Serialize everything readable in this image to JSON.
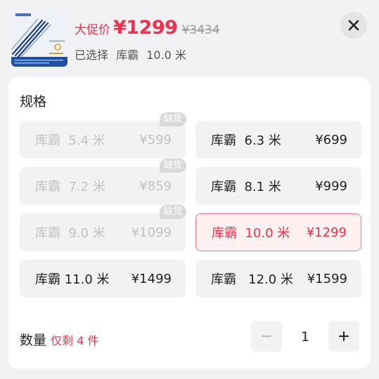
{
  "header": {
    "promo_label": "大促价",
    "price_now": "¥1299",
    "price_old": "¥3434",
    "selected_prefix": "已选择",
    "selected_name": "库霸",
    "selected_length": "10.0 米",
    "close_icon": "close-icon",
    "thumb_icon": "product-thumbnail-icon"
  },
  "spec": {
    "title": "规格",
    "badge_text": "缺货",
    "options": [
      {
        "name": "库霸  5.4 米",
        "price": "¥599",
        "state": "disabled",
        "badge": "缺货"
      },
      {
        "name": "库霸  6.3 米",
        "price": "¥699",
        "state": "normal"
      },
      {
        "name": "库霸  7.2 米",
        "price": "¥859",
        "state": "disabled",
        "badge": "缺货"
      },
      {
        "name": "库霸  8.1 米",
        "price": "¥999",
        "state": "normal"
      },
      {
        "name": "库霸  9.0 米",
        "price": "¥1099",
        "state": "disabled",
        "badge": "缺货"
      },
      {
        "name": "库霸  10.0 米",
        "price": "¥1299",
        "state": "selected"
      },
      {
        "name": "库霸 11.0 米",
        "price": "¥1499",
        "state": "normal"
      },
      {
        "name": "库霸   12.0 米",
        "price": "¥1599",
        "state": "normal"
      }
    ]
  },
  "quantity": {
    "label": "数量",
    "stock_note": "仅剩 4 件",
    "value": "1",
    "minus_icon": "minus-icon",
    "plus_icon": "plus-icon"
  },
  "colors": {
    "accent": "#f0314d",
    "disabled_text": "#c2c2c2",
    "option_bg": "#f2f2f4",
    "selected_bg": "#fff0f1",
    "selected_border": "#f4798a"
  }
}
